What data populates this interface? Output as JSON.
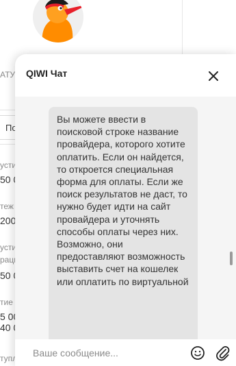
{
  "background_page": {
    "header_label": "АТУ",
    "tab_label": "По",
    "rows": [
      {
        "label": "усти",
        "value": "50 0"
      },
      {
        "label": "теж",
        "value": "200"
      },
      {
        "label": "усти",
        "value": ""
      },
      {
        "label": "раци",
        "value": "50 0"
      },
      {
        "label": "тие",
        "value": "5 00"
      },
      {
        "label": "",
        "value": "40 0"
      },
      {
        "label": "тупл",
        "value": ""
      }
    ]
  },
  "chat": {
    "title": "QIWI Чат",
    "message": "Вы можете ввести в поисковой строке название провайдера, которого хотите оплатить. Если он найдется, то откроется специальная форма для оплаты. Если же поиск результатов не даст, то нужно будет идти на сайт провайдера и уточнять способы оплаты через них. Возможно, они предоставляют возможность выставить счет на кошелек или оплатить по виртуальной",
    "input_placeholder": "Ваше сообщение...",
    "icons": {
      "close": "close-icon",
      "scroll_down": "chevron-down-icon",
      "emoji": "smile-icon",
      "attach": "paperclip-icon"
    }
  },
  "colors": {
    "accent": "#ff8c00",
    "bubble": "#e4e4e4",
    "messages_bg": "#f5f5f5"
  }
}
